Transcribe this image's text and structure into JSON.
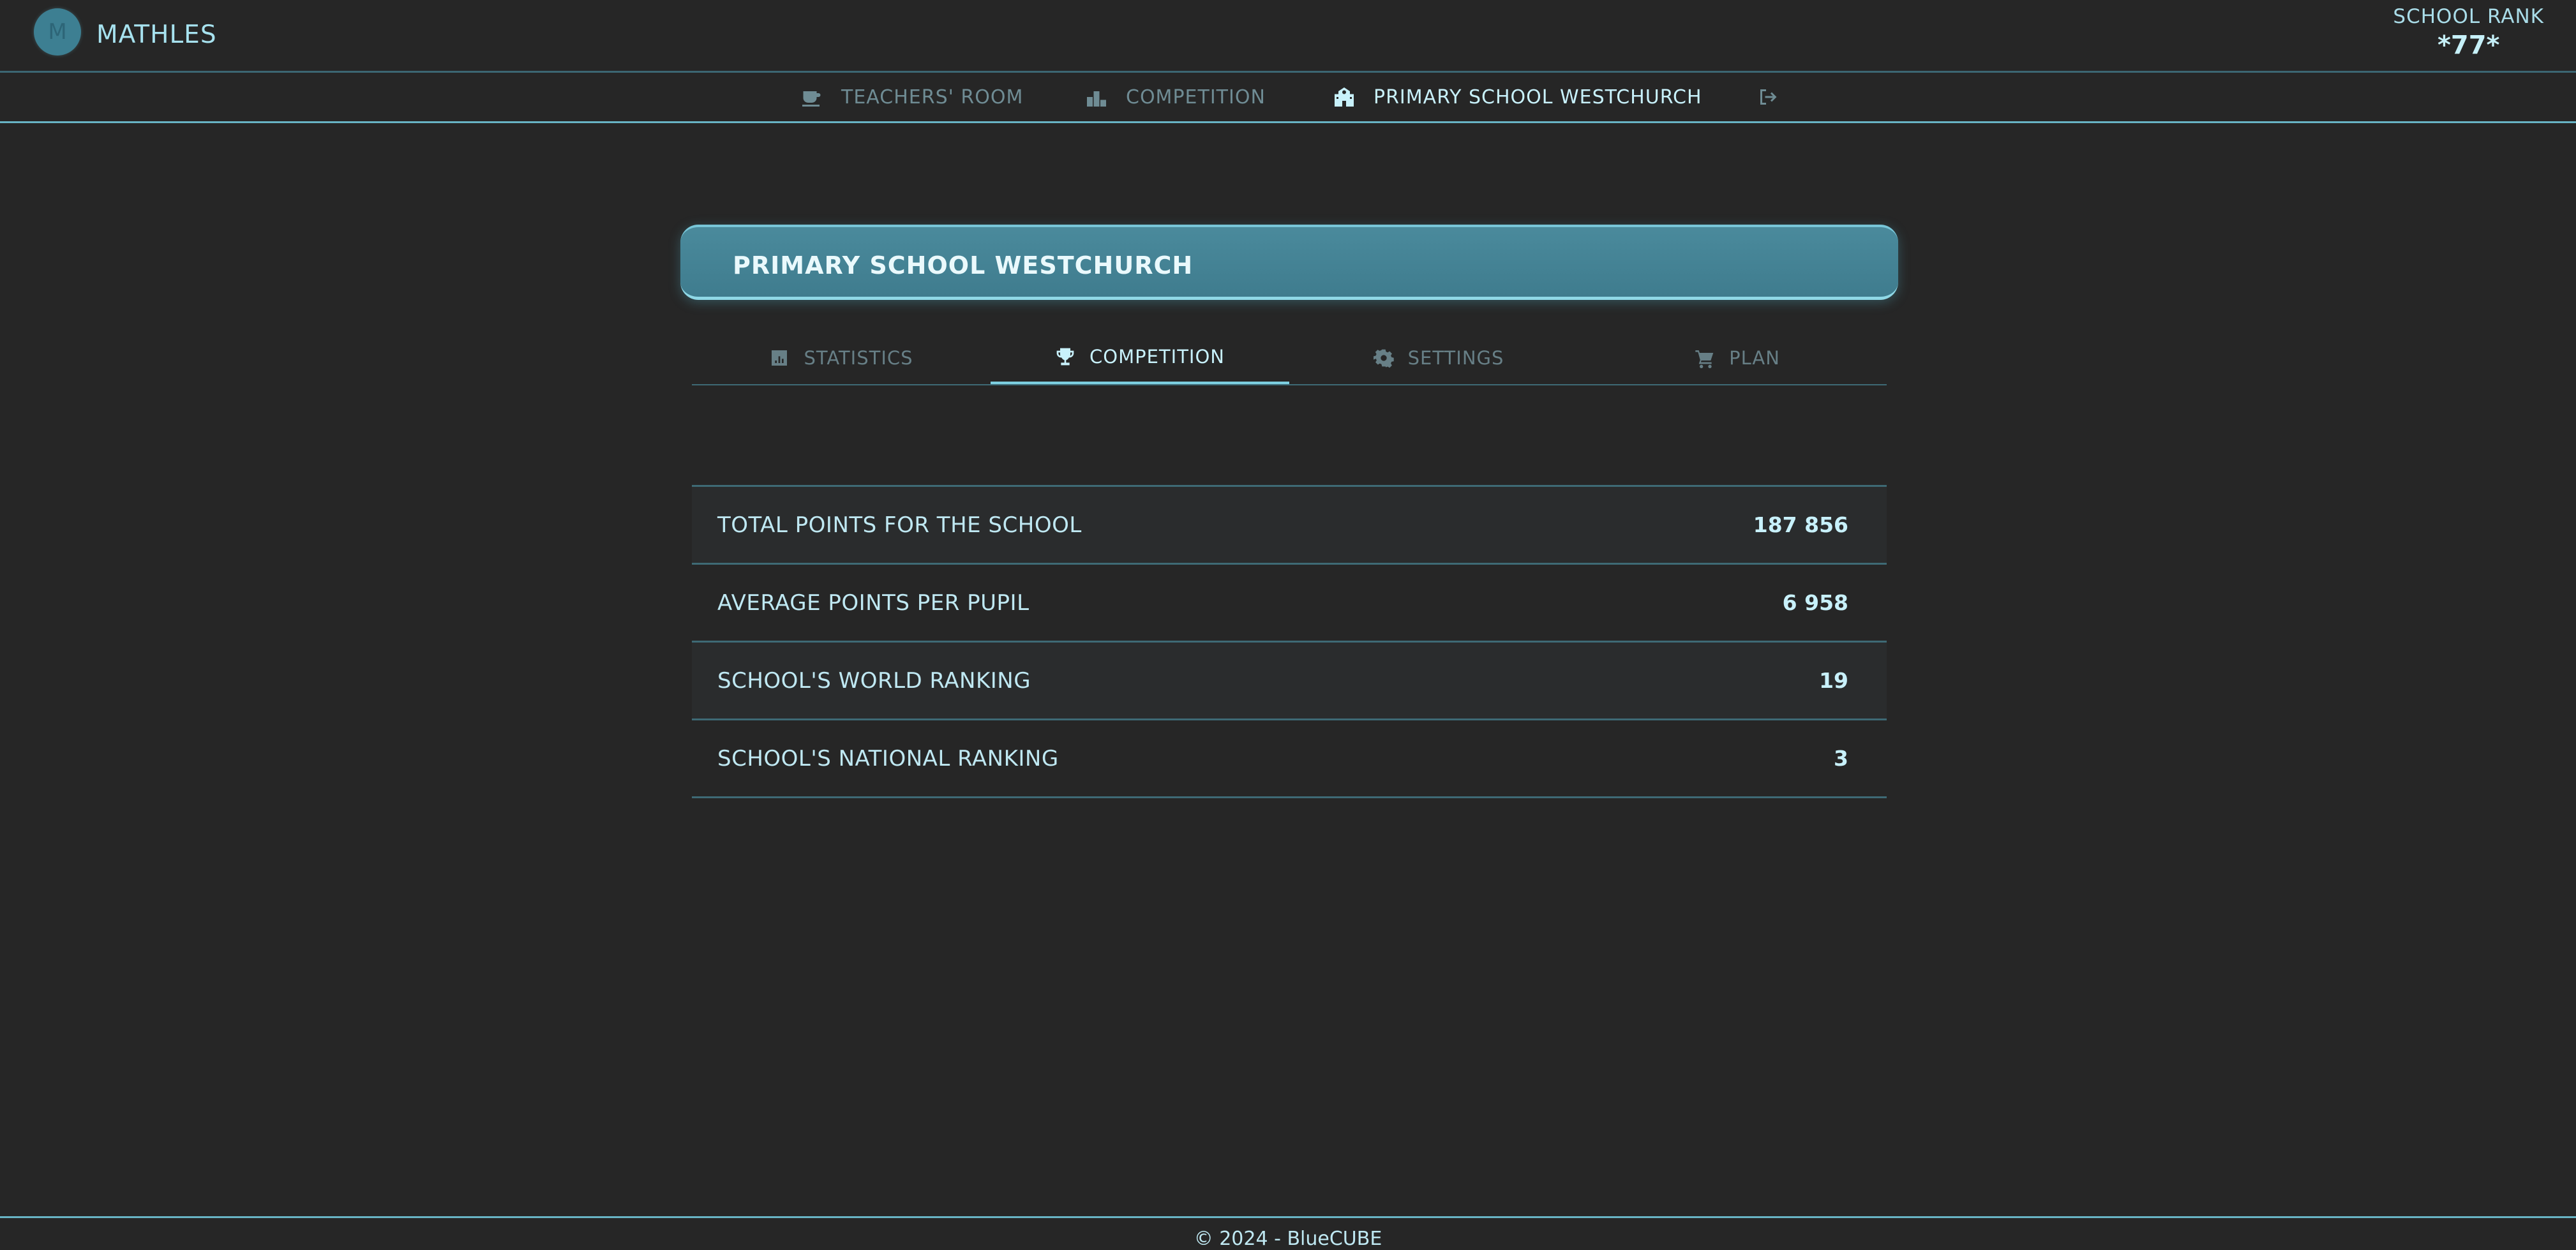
{
  "header": {
    "logo_letter": "M",
    "brand": "MATHLES",
    "rank_label": "SCHOOL RANK",
    "rank_value": "*77*"
  },
  "topnav": {
    "items": [
      {
        "label": "TEACHERS' ROOM",
        "icon": "coffee-icon",
        "active": false
      },
      {
        "label": "COMPETITION",
        "icon": "podium-icon",
        "active": false
      },
      {
        "label": "PRIMARY SCHOOL WESTCHURCH",
        "icon": "school-icon",
        "active": true
      },
      {
        "label": "",
        "icon": "logout-icon",
        "active": false
      }
    ]
  },
  "card": {
    "title": "PRIMARY SCHOOL WESTCHURCH"
  },
  "subtabs": [
    {
      "label": "STATISTICS",
      "icon": "chart-icon",
      "active": false
    },
    {
      "label": "COMPETITION",
      "icon": "trophy-icon",
      "active": true
    },
    {
      "label": "SETTINGS",
      "icon": "gear-icon",
      "active": false
    },
    {
      "label": "PLAN",
      "icon": "cart-icon",
      "active": false
    }
  ],
  "stats": [
    {
      "label": "TOTAL POINTS FOR THE SCHOOL",
      "value": "187 856"
    },
    {
      "label": "AVERAGE POINTS PER PUPIL",
      "value": "6 958"
    },
    {
      "label": "SCHOOL'S WORLD RANKING",
      "value": "19"
    },
    {
      "label": "SCHOOL'S NATIONAL RANKING",
      "value": "3"
    }
  ],
  "footer": {
    "text": "© 2024 - BlueCUBE"
  },
  "colors": {
    "background": "#262626",
    "accent": "#7dcfe0",
    "header_card": "#427f91",
    "text": "#bfe8f2",
    "muted": "#6f8c94"
  }
}
